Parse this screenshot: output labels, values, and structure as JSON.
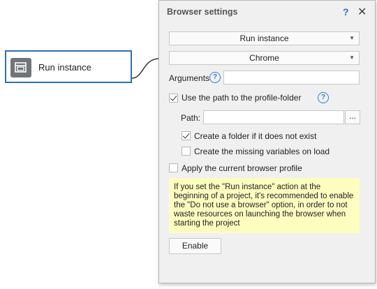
{
  "node": {
    "label": "Run instance",
    "icon": "browser-window-icon"
  },
  "panel": {
    "title": "Browser settings",
    "help_symbol": "?",
    "close_symbol": "✕",
    "action_select": "Run instance",
    "browser_select": "Chrome",
    "arguments_label": "Arguments",
    "arguments_value": "",
    "use_profile_path_label": "Use the path to the profile-folder",
    "use_profile_path_checked": true,
    "path_label": "Path:",
    "path_value": "",
    "browse_label": "...",
    "create_folder_label": "Create a folder if it does not exist",
    "create_folder_checked": true,
    "create_variables_label": "Create the missing variables on load",
    "create_variables_checked": false,
    "apply_profile_label": "Apply the current browser profile",
    "apply_profile_checked": false,
    "note_text": "If you set the \"Run instance\" action at the beginning of a project,  it's recommended to enable the \"Do not use a browser\" option, in order to not waste resources on launching the browser when starting the project",
    "enable_button": "Enable"
  },
  "colors": {
    "node_border": "#2f6fb5",
    "panel_bg": "#f0f0f0",
    "note_bg": "#fdfdc0",
    "help_blue": "#2f7dd4"
  }
}
